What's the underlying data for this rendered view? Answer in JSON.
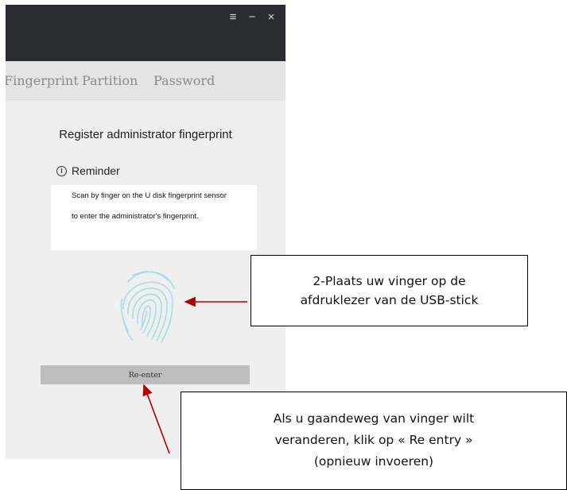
{
  "window": {
    "controls": {
      "menu": "≡",
      "minimize": "−",
      "close": "×"
    },
    "tabs": [
      "Fingerprint",
      "Partition",
      "Password"
    ],
    "title": "Register administrator fingerprint",
    "reminder": {
      "heading": "Reminder",
      "line1": "Scan by finger on the U disk fingerprint sensor",
      "line2": "to enter the administrator's fingerprint."
    },
    "reenter_label": "Re-enter"
  },
  "callouts": {
    "fingerprint": {
      "line1": "2-Plaats uw vinger op de",
      "line2": "afdruklezer van de USB-stick"
    },
    "reenter": {
      "line1": "Als u gaandeweg van vinger wilt",
      "line2": "veranderen, klik op « Re entry »",
      "line3": "(opnieuw invoeren)"
    }
  },
  "colors": {
    "titlebar": "#2b2b33",
    "tabbar": "#e4e4e4",
    "background": "#efefef",
    "fingerprint": "#9fdce8",
    "arrow": "#b30000"
  }
}
